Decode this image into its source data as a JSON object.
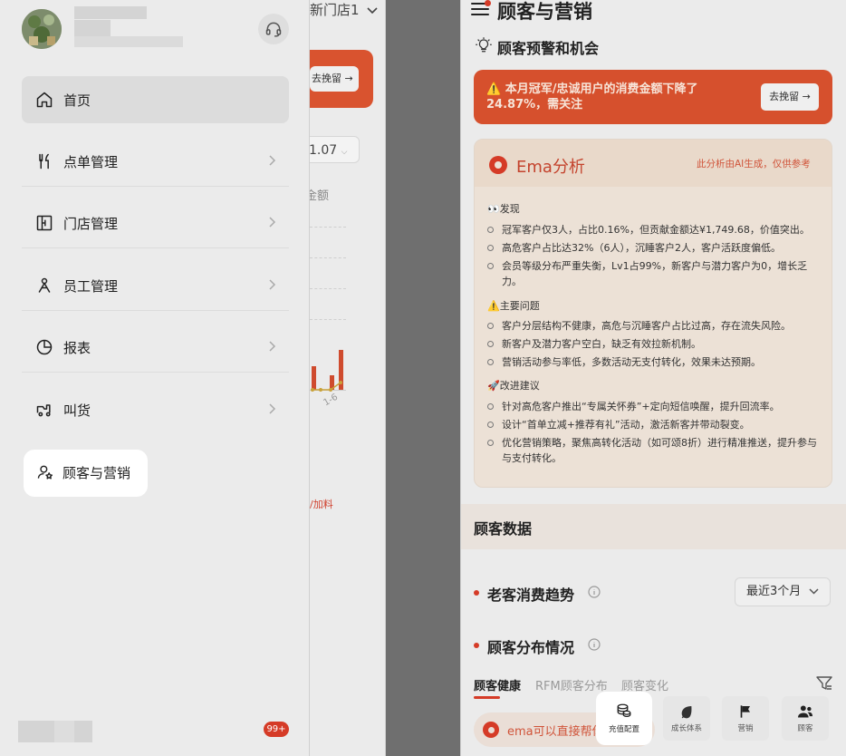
{
  "drawer": {
    "badge": "99+",
    "items": [
      {
        "label": "首页",
        "icon": "home-icon"
      },
      {
        "label": "点单管理",
        "icon": "fork-knife-icon"
      },
      {
        "label": "门店管理",
        "icon": "store-icon"
      },
      {
        "label": "员工管理",
        "icon": "staff-icon"
      },
      {
        "label": "报表",
        "icon": "pie-chart-icon"
      },
      {
        "label": "叫货",
        "icon": "truck-icon"
      },
      {
        "label": "顾客与营销",
        "icon": "customer-star-icon"
      }
    ]
  },
  "background_page": {
    "store_name": "新门店1",
    "retain_button": "去挽留",
    "date_value": "1.07",
    "amount_label": "金额",
    "tick_label": "1-6",
    "topping_text": "/加料"
  },
  "main": {
    "title": "顾客与营销",
    "alert_section_title": "顾客预警和机会",
    "warning": {
      "text": "⚠️ 本月冠军/忠诚用户的消费金额下降了24.87%，需关注",
      "button": "去挽留"
    },
    "ai": {
      "name": "Ema分析",
      "disclaimer": "此分析由AI生成，仅供参考",
      "sections": [
        {
          "title": "👀发现",
          "items": [
            "冠军客户仅3人，占比0.16%，但贡献金额达¥1,749.68，价值突出。",
            "高危客户占比达32%（6人），沉睡客户2人，客户活跃度偏低。",
            "会员等级分布严重失衡，Lv1占99%，新客户与潜力客户为0，增长乏力。"
          ]
        },
        {
          "title": "⚠️主要问题",
          "items": [
            "客户分层结构不健康，高危与沉睡客户占比过高，存在流失风险。",
            "新客户及潜力客户空白，缺乏有效拉新机制。",
            "营销活动参与率低，多数活动无支付转化，效果未达预期。"
          ]
        },
        {
          "title": "🚀改进建议",
          "items": [
            "针对高危客户推出“专属关怀券”+定向短信唤醒，提升回流率。",
            "设计“首单立减+推荐有礼”活动，激活新客并带动裂变。",
            "优化营销策略，聚焦高转化活动（如可颂8折）进行精准推送，提升参与与支付转化。"
          ]
        }
      ]
    },
    "customer_data_title": "顾客数据",
    "trend_title": "老客消费趋势",
    "range_select": "最近3个月",
    "distribution_title": "顾客分布情况",
    "tabs": [
      "顾客健康",
      "RFM顾客分布",
      "顾客变化"
    ],
    "active_tab": "顾客健康",
    "ema_prompt": "ema可以直接帮你找",
    "quick_actions": [
      {
        "label": "充值配置",
        "icon": "coins-icon"
      },
      {
        "label": "成长体系",
        "icon": "leaf-icon"
      },
      {
        "label": "营销",
        "icon": "flag-icon"
      },
      {
        "label": "顾客",
        "icon": "users-icon"
      }
    ]
  },
  "colors": {
    "accent": "#d53b27",
    "warning_bg": "#d6502d",
    "ai_text": "#c4432d"
  }
}
